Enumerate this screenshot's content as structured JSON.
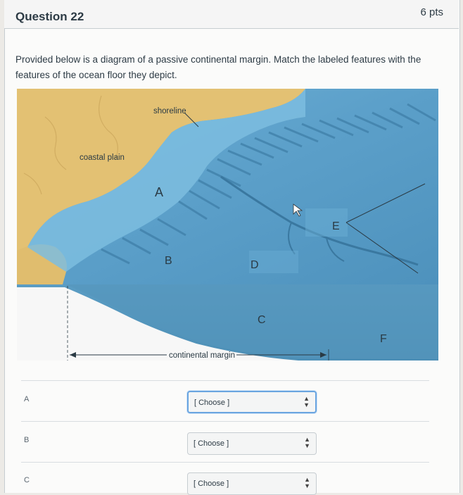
{
  "question": {
    "title": "Question 22",
    "points": "6 pts",
    "text": "Provided below is a diagram of a passive continental margin. Match the labeled features with the features of the ocean floor they depict."
  },
  "diagram": {
    "labels": {
      "shoreline": "shoreline",
      "coastal_plain": "coastal plain",
      "continental_margin": "continental margin",
      "A": "A",
      "B": "B",
      "C": "C",
      "D": "D",
      "E": "E",
      "F": "F"
    }
  },
  "matches": [
    {
      "letter": "A",
      "value": "[ Choose ]"
    },
    {
      "letter": "B",
      "value": "[ Choose ]"
    },
    {
      "letter": "C",
      "value": "[ Choose ]"
    }
  ],
  "colors": {
    "land": "#e3c173",
    "ocean": "#5b9fc9",
    "deep_ocean": "#4a8fb8",
    "focus": "#6aa5e0"
  }
}
